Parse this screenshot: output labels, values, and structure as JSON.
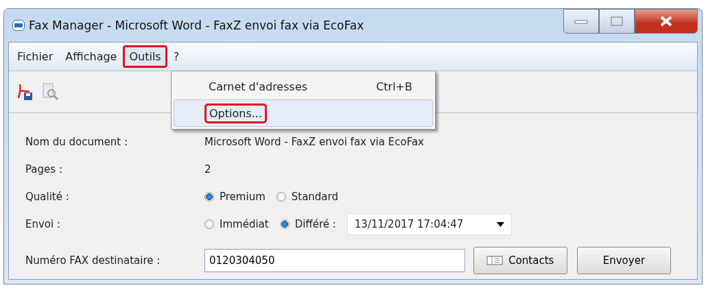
{
  "window": {
    "title": "Fax Manager - Microsoft Word - FaxZ envoi fax via EcoFax"
  },
  "menu": [
    {
      "label": "Fichier",
      "highlighted": false
    },
    {
      "label": "Affichage",
      "highlighted": false
    },
    {
      "label": "Outils",
      "highlighted": true
    },
    {
      "label": "?",
      "highlighted": false
    }
  ],
  "dropdown": [
    {
      "label": "Carnet d'adresses",
      "shortcut": "Ctrl+B",
      "highlighted": false
    },
    {
      "label": "Options...",
      "highlighted": true
    }
  ],
  "form": {
    "document_label": "Nom du document :",
    "document_value": "Microsoft Word - FaxZ envoi fax via EcoFax",
    "pages_label": "Pages :",
    "pages_value": "2",
    "quality_label": "Qualité :",
    "quality_options": [
      {
        "label": "Premium",
        "selected": true
      },
      {
        "label": "Standard",
        "selected": false
      }
    ],
    "send_label": "Envoi :",
    "send_options": [
      {
        "label": "Immédiat",
        "selected": false
      },
      {
        "label": "Différé :",
        "selected": true
      }
    ],
    "datetime": "13/11/2017 17:04:47",
    "fax_label": "Numéro FAX destinataire :",
    "fax_value": "0120304050"
  },
  "buttons": [
    {
      "label": "Contacts",
      "kind": "contacts"
    },
    {
      "label": "Envoyer",
      "kind": "send"
    }
  ]
}
